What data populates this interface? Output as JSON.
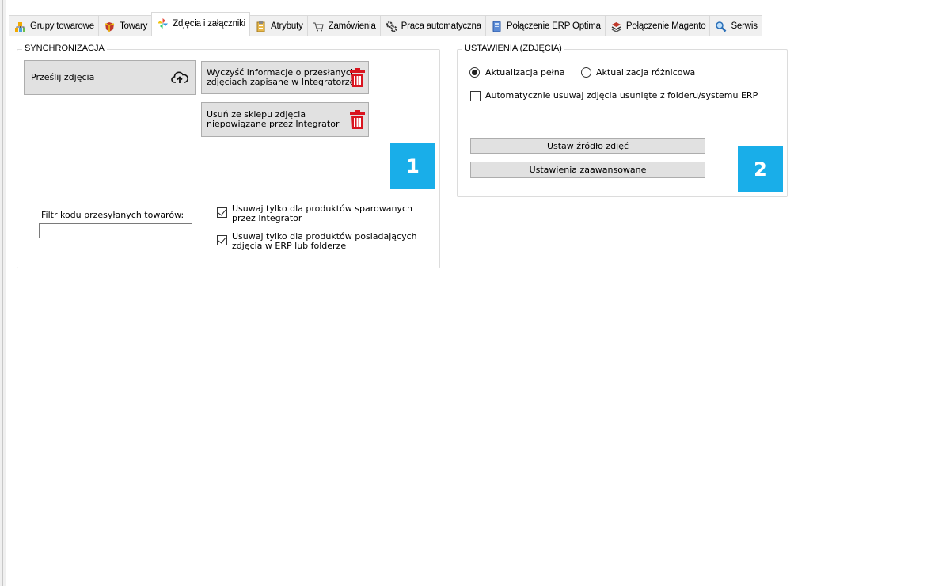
{
  "tabs": [
    {
      "label": "Grupy towarowe",
      "icon": "groups-icon",
      "active": false
    },
    {
      "label": "Towary",
      "icon": "products-icon",
      "active": false
    },
    {
      "label": "Zdjęcia i załączniki",
      "icon": "pinwheel-icon",
      "active": true
    },
    {
      "label": "Atrybuty",
      "icon": "clipboard-icon",
      "active": false
    },
    {
      "label": "Zamówienia",
      "icon": "cart-icon",
      "active": false
    },
    {
      "label": "Praca automatyczna",
      "icon": "gears-icon",
      "active": false
    },
    {
      "label": "Połączenie ERP Optima",
      "icon": "erp-icon",
      "active": false
    },
    {
      "label": "Połączenie Magento",
      "icon": "magento-icon",
      "active": false
    },
    {
      "label": "Serwis",
      "icon": "magnifier-icon",
      "active": false
    }
  ],
  "sync": {
    "title": "SYNCHRONIZACJA",
    "upload_button": "Prześlij zdjęcia",
    "clear_button_line1": "Wyczyść informacje o przesłanych",
    "clear_button_line2": "zdjęciach zapisane w Integratorze",
    "remove_button_line1": "Usuń ze sklepu zdjęcia",
    "remove_button_line2": "niepowiązane przez Integrator",
    "badge": "1",
    "filter_label": "Filtr kodu przesyłanych towarów:",
    "filter_value": "",
    "check1_line1": "Usuwaj tylko dla produktów sparowanych",
    "check1_line2": "przez Integrator",
    "check1_checked": true,
    "check2_line1": "Usuwaj tylko dla produktów posiadających",
    "check2_line2": "zdjęcia w ERP lub folderze",
    "check2_checked": true
  },
  "settings": {
    "title": "USTAWIENIA (ZDJĘCIA)",
    "radio_full": "Aktualizacja pełna",
    "radio_diff": "Aktualizacja różnicowa",
    "selected_radio": "Aktualizacja pełna",
    "auto_delete": "Automatycznie usuwaj zdjęcia usunięte z folderu/systemu ERP",
    "auto_delete_checked": false,
    "source_button": "Ustaw źródło zdjęć",
    "advanced_button": "Ustawienia zaawansowane",
    "badge": "2"
  },
  "colors": {
    "badge_bg": "#19aee9",
    "bin_red": "#d9141f"
  }
}
